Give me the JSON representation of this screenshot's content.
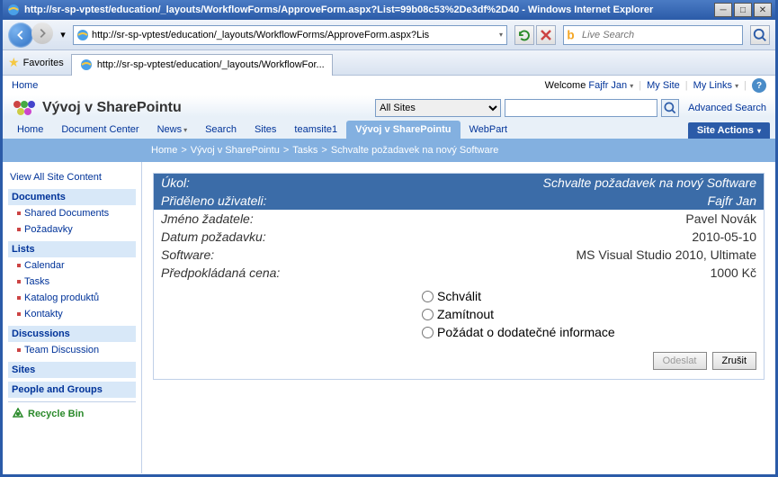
{
  "titlebar": {
    "title": "http://sr-sp-vptest/education/_layouts/WorkflowForms/ApproveForm.aspx?List=99b08c53%2De3df%2D40 - Windows Internet Explorer"
  },
  "addressbar": {
    "url": "http://sr-sp-vptest/education/_layouts/WorkflowForms/ApproveForm.aspx?Lis",
    "search_placeholder": "Live Search"
  },
  "favbar": {
    "favorites_label": "Favorites",
    "tab_title": "http://sr-sp-vptest/education/_layouts/WorkflowFor..."
  },
  "sp_topbar": {
    "home": "Home",
    "welcome_prefix": "Welcome ",
    "user": "Fajfr Jan",
    "mysite": "My Site",
    "mylinks": "My Links"
  },
  "sp_title": "Vývoj v SharePointu",
  "sp_search": {
    "scope": "All Sites",
    "advanced": "Advanced Search"
  },
  "topnav": {
    "items": [
      "Home",
      "Document Center",
      "News",
      "Search",
      "Sites",
      "teamsite1",
      "Vývoj v SharePointu",
      "WebPart"
    ],
    "site_actions": "Site Actions"
  },
  "breadcrumb": {
    "parts": [
      "Home",
      "Vývoj v SharePointu",
      "Tasks"
    ],
    "current": "Schvalte požadavek na nový Software"
  },
  "leftnav": {
    "view_all": "View All Site Content",
    "sections": [
      {
        "header": "Documents",
        "items": [
          "Shared Documents",
          "Požadavky"
        ]
      },
      {
        "header": "Lists",
        "items": [
          "Calendar",
          "Tasks",
          "Katalog produktů",
          "Kontakty"
        ]
      },
      {
        "header": "Discussions",
        "items": [
          "Team Discussion"
        ]
      },
      {
        "header": "Sites",
        "items": []
      },
      {
        "header": "People and Groups",
        "items": []
      }
    ],
    "recycle": "Recycle Bin"
  },
  "task": {
    "rows_header": [
      {
        "label": "Úkol:",
        "value": "Schvalte požadavek na nový Software"
      },
      {
        "label": "Přiděleno uživateli:",
        "value": "Fajfr Jan"
      }
    ],
    "rows_body": [
      {
        "label": "Jméno žadatele:",
        "value": "Pavel Novák"
      },
      {
        "label": "Datum požadavku:",
        "value": "2010-05-10"
      },
      {
        "label": "Software:",
        "value": "MS Visual Studio 2010, Ultimate"
      },
      {
        "label": "Předpokládaná cena:",
        "value": "1000 Kč"
      }
    ],
    "options": [
      "Schválit",
      "Zamítnout",
      "Požádat o dodatečné informace"
    ],
    "buttons": {
      "submit": "Odeslat",
      "cancel": "Zrušit"
    }
  }
}
